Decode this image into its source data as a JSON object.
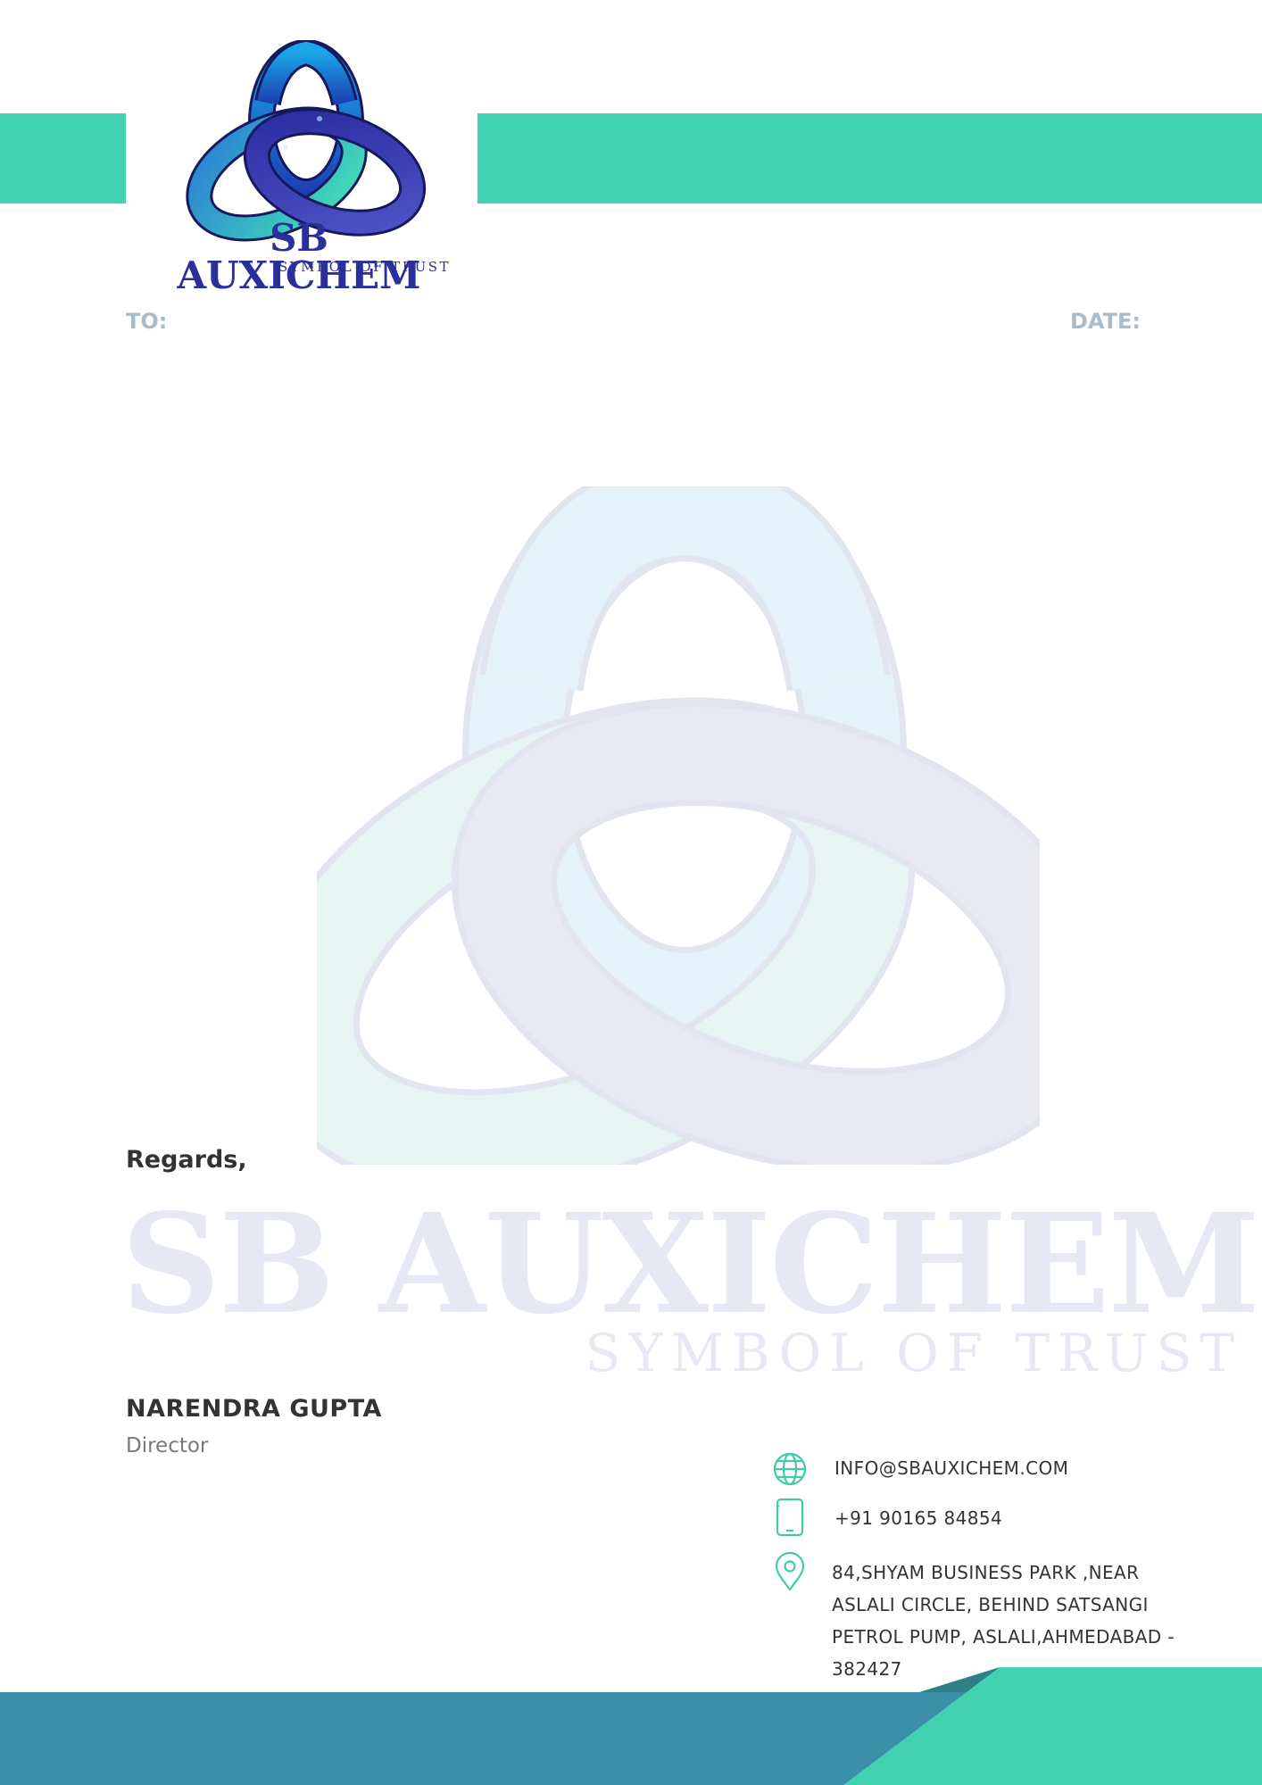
{
  "brand": {
    "name": "SB AUXICHEM",
    "tagline": "SYMBOL OF TRUST",
    "colors": {
      "accent": "#42d2b1",
      "navy": "#2a2f9a",
      "footer_blue": "#3b8fa8",
      "label_gray": "#a9bccb"
    }
  },
  "letter": {
    "to_label": "TO:",
    "date_label": "DATE:",
    "closing": "Regards,",
    "signatory_name": "NARENDRA GUPTA",
    "signatory_title": "Director"
  },
  "watermark": {
    "name": "SB AUXICHEM",
    "tagline": "SYMBOL OF TRUST"
  },
  "contacts": [
    {
      "icon": "globe-icon",
      "text": "INFO@SBAUXICHEM.COM"
    },
    {
      "icon": "phone-icon",
      "text": "+91 90165 84854"
    },
    {
      "icon": "location-pin-icon",
      "text": "84,SHYAM BUSINESS PARK ,NEAR ASLALI CIRCLE, BEHIND SATSANGI PETROL PUMP, ASLALI,AHMEDABAD - 382427"
    }
  ]
}
